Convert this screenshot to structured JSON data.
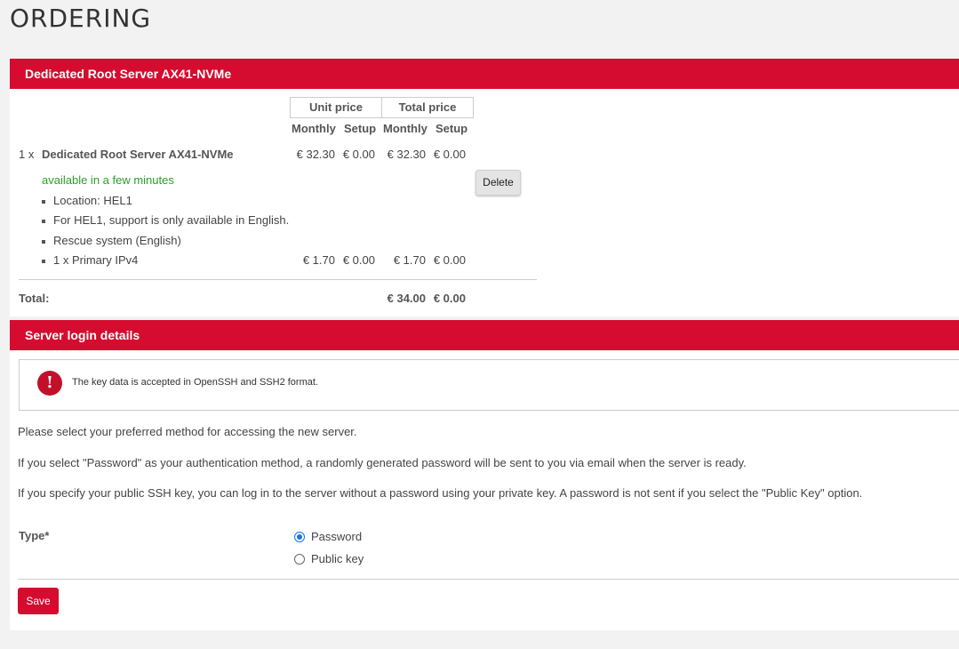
{
  "page": {
    "title": "ORDERING"
  },
  "order": {
    "header": "Dedicated Root Server AX41-NVMe",
    "unit_price_label": "Unit price",
    "total_price_label": "Total price",
    "col_monthly": "Monthly",
    "col_setup": "Setup",
    "item": {
      "qty": "1 x",
      "name": "Dedicated Root Server AX41-NVMe",
      "unit_monthly": "€ 32.30",
      "unit_setup": "€ 0.00",
      "total_monthly": "€ 32.30",
      "total_setup": "€ 0.00",
      "delete_label": "Delete",
      "availability": "available in a few minutes"
    },
    "details": [
      {
        "text": "Location: HEL1"
      },
      {
        "text": "For HEL1, support is only available in English."
      },
      {
        "text": "Rescue system (English)"
      },
      {
        "text": "1 x Primary IPv4",
        "unit_monthly": "€ 1.70",
        "unit_setup": "€ 0.00",
        "total_monthly": "€ 1.70",
        "total_setup": "€ 0.00"
      }
    ],
    "total": {
      "label": "Total:",
      "monthly": "€ 34.00",
      "setup": "€ 0.00"
    }
  },
  "login": {
    "header": "Server login details",
    "info_icon": "exclamation-icon",
    "info_text": "The key data is accepted in OpenSSH and SSH2 format.",
    "paragraphs": [
      "Please select your preferred method for accessing the new server.",
      "If you select \"Password\" as your authentication method, a randomly generated password will be sent to you via email when the server is ready.",
      "If you specify your public SSH key, you can log in to the server without a password using your private key. A password is not sent if you select the \"Public Key\" option."
    ],
    "type_label": "Type*",
    "options": [
      {
        "label": "Password",
        "checked": true
      },
      {
        "label": "Public key",
        "checked": false
      }
    ],
    "save_label": "Save"
  },
  "colors": {
    "accent": "#d50c2f",
    "available": "#2aa02a",
    "radio": "#1a73e8"
  }
}
